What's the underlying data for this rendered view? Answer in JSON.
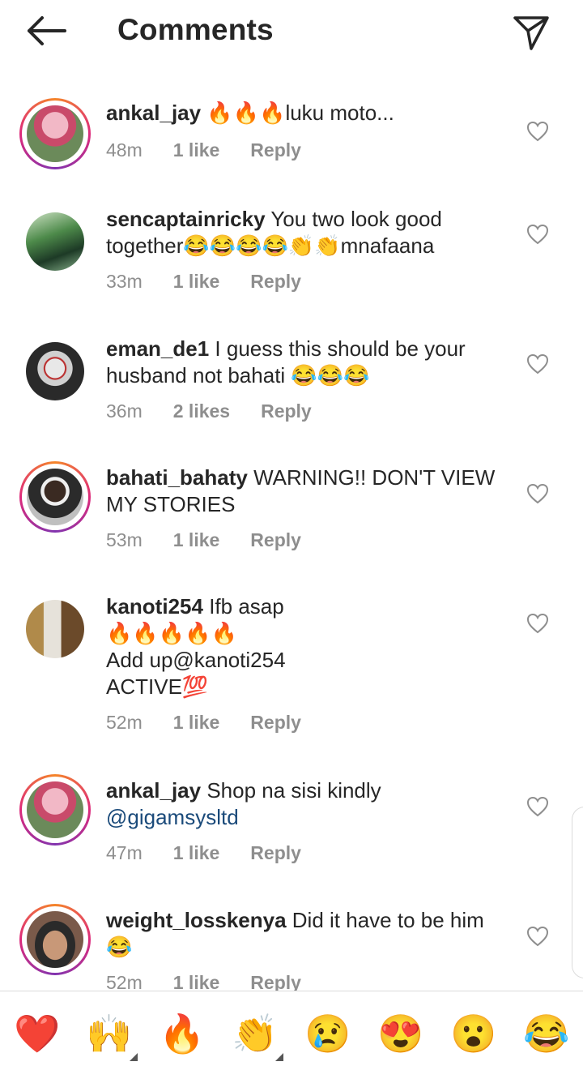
{
  "header": {
    "title": "Comments",
    "back_icon": "arrow-left-icon",
    "send_icon": "paper-plane-icon"
  },
  "colors": {
    "ring_gradient": [
      "#f58529",
      "#dd2a7b",
      "#8134af"
    ],
    "mention": "#1a4a7a",
    "meta": "#8e8e8e"
  },
  "comments": [
    {
      "username": "ankal_jay",
      "text_lines": [
        "🔥🔥🔥luku moto..."
      ],
      "time": "48m",
      "likes": "1 like",
      "reply": "Reply",
      "story_ring": true
    },
    {
      "username": "sencaptainricky",
      "text_lines": [
        "You two look good",
        "together😂😂😂😂👏👏mnafaana"
      ],
      "time": "33m",
      "likes": "1 like",
      "reply": "Reply",
      "story_ring": false
    },
    {
      "username": "eman_de1",
      "text_lines": [
        "I guess this should be your",
        "husband not bahati 😂😂😂"
      ],
      "time": "36m",
      "likes": "2 likes",
      "reply": "Reply",
      "story_ring": false
    },
    {
      "username": "bahati_bahaty",
      "text_lines": [
        "WARNING!! DON'T VIEW",
        "MY STORIES"
      ],
      "time": "53m",
      "likes": "1 like",
      "reply": "Reply",
      "story_ring": true
    },
    {
      "username": "kanoti254",
      "text_lines": [
        "Ifb asap",
        "🔥🔥🔥🔥🔥",
        "Add up@kanoti254",
        "ACTIVE💯"
      ],
      "time": "52m",
      "likes": "1 like",
      "reply": "Reply",
      "story_ring": false
    },
    {
      "username": "ankal_jay",
      "text_lines": [
        "Shop na sisi kindly"
      ],
      "mention": "@gigamsysltd",
      "time": "47m",
      "likes": "1 like",
      "reply": "Reply",
      "story_ring": true
    },
    {
      "username": "weight_losskenya",
      "text_lines": [
        "Did it have to be him",
        "😂"
      ],
      "time": "52m",
      "likes": "1 like",
      "reply": "Reply",
      "story_ring": true
    }
  ],
  "quick_emojis": [
    "❤️",
    "🙌",
    "🔥",
    "👏",
    "😢",
    "😍",
    "😮",
    "😂"
  ]
}
